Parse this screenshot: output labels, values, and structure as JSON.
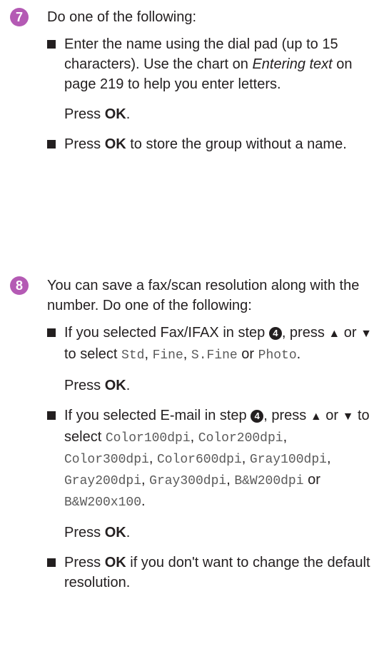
{
  "step7": {
    "number": "7",
    "text": "Do one of the following:",
    "bullet1": {
      "t1": "Enter the name using the dial pad (up to 15 characters). Use the chart on ",
      "italic": "Entering text",
      "t2": " on page 219 to help you enter letters.",
      "press": "Press",
      "ok": "OK",
      "dot": "."
    },
    "bullet2": {
      "press": "Press",
      "ok": "OK",
      "rest": " to store the group without a name."
    }
  },
  "step8": {
    "number": "8",
    "text": "You can save a fax/scan resolution along with the number. Do one of the following:",
    "bullet1": {
      "t1": "If you selected Fax/IFAX in step ",
      "step_ref": "4",
      "t2": ", press ",
      "up": "▲",
      "or": " or ",
      "down": "▼",
      "t3": " to select ",
      "opt1": "Std",
      "comma1": ", ",
      "opt2": "Fine",
      "comma2": ", ",
      "opt3": "S.Fine",
      "or2": " or ",
      "opt4": "Photo",
      "end": ".",
      "press": "Press",
      "ok": "OK",
      "dot": "."
    },
    "bullet2": {
      "t1": "If you selected E-mail in step ",
      "step_ref": "4",
      "t2": ", press ",
      "up": "▲",
      "or": " or ",
      "down": "▼",
      "t3": " to select ",
      "opts": [
        "Color100dpi",
        "Color200dpi",
        "Color300dpi",
        "Color600dpi",
        "Gray100dpi",
        "Gray200dpi",
        "Gray300dpi",
        "B&W200dpi"
      ],
      "or2": " or ",
      "last": "B&W200x100",
      "end": ".",
      "press": "Press",
      "ok": "OK",
      "dot": "."
    },
    "bullet3": {
      "press": "Press",
      "ok": "OK",
      "rest": " if you don't want to change the default resolution."
    }
  }
}
